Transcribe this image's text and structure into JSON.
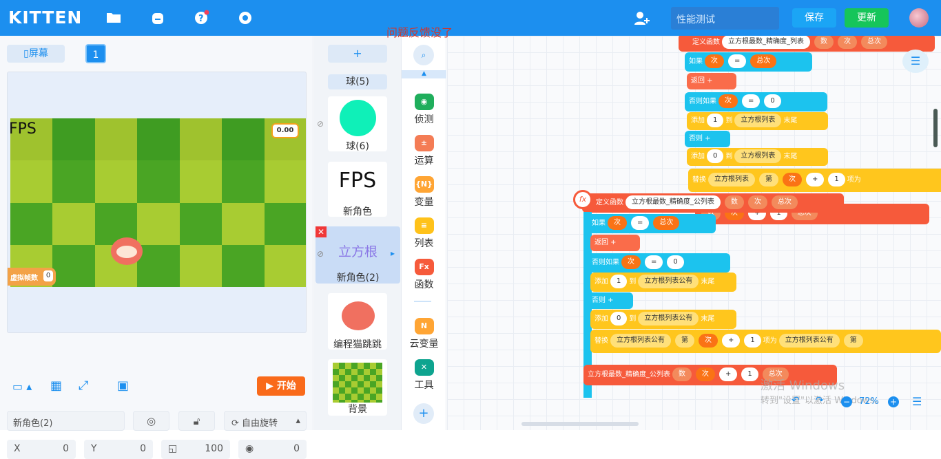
{
  "app": {
    "logo": "KITTEN",
    "project_name_placeholder": "性能测试",
    "save": "保存",
    "update": "更新"
  },
  "overlay_text": "问题反馈没了",
  "stage": {
    "screen_btn": "屏幕",
    "screen_num": "1",
    "fps_label": "FPS",
    "fps_value": "0.00",
    "virtual_fps_label": "虚拟帧数",
    "virtual_fps_value": "0",
    "start": "开始"
  },
  "sprite_props": {
    "name": "新角色(2)",
    "rotation": "自由旋转",
    "x_label": "X",
    "x": "0",
    "y_label": "Y",
    "y": "0",
    "size": "100",
    "dir": "0"
  },
  "sprites": [
    {
      "label": "球(5)"
    },
    {
      "label": "球(6)"
    },
    {
      "label": "新角色",
      "img_text": "FPS"
    },
    {
      "label": "新角色(2)",
      "img_text": "立方根"
    },
    {
      "label": "编程猫跳跳"
    },
    {
      "label": "背景"
    }
  ],
  "add_sprite": "+",
  "categories": [
    {
      "label": "侦测",
      "color": "#1fae5c",
      "icon": "◉"
    },
    {
      "label": "运算",
      "color": "#f47c55",
      "icon": "±"
    },
    {
      "label": "变量",
      "color": "#ffa534",
      "icon": "{N}"
    },
    {
      "label": "列表",
      "color": "#ffc21a",
      "icon": "≡"
    },
    {
      "label": "函数",
      "color": "#f65a3b",
      "icon": "Fx"
    },
    {
      "label": "云变量",
      "color": "#ffa534",
      "icon": "N"
    },
    {
      "label": "工具",
      "color": "#0ea48f",
      "icon": "✕"
    }
  ],
  "blocks": {
    "def": "定义函数",
    "fn1": "立方根最数_精确度_列表",
    "fn2": "立方根最数_精确度_公列表",
    "num": "数",
    "ci": "次",
    "total": "总次",
    "if": "如果",
    "eq": "=",
    "return": "返回",
    "elif": "否则如果",
    "zero": "0",
    "one": "1",
    "add": "添加",
    "to": "到",
    "list1": "立方根列表",
    "list2": "立方根列表公有",
    "end": "末尾",
    "else": "否则",
    "replace": "替换",
    "nth": "第",
    "plus": "+",
    "item": "项为",
    "call_fn": "立方根最数_精确度_公列表"
  },
  "footer": {
    "watermark1": "激活 Windows",
    "watermark2": "转到\"设置\"以激活 Windows。",
    "zoom": "72%"
  }
}
